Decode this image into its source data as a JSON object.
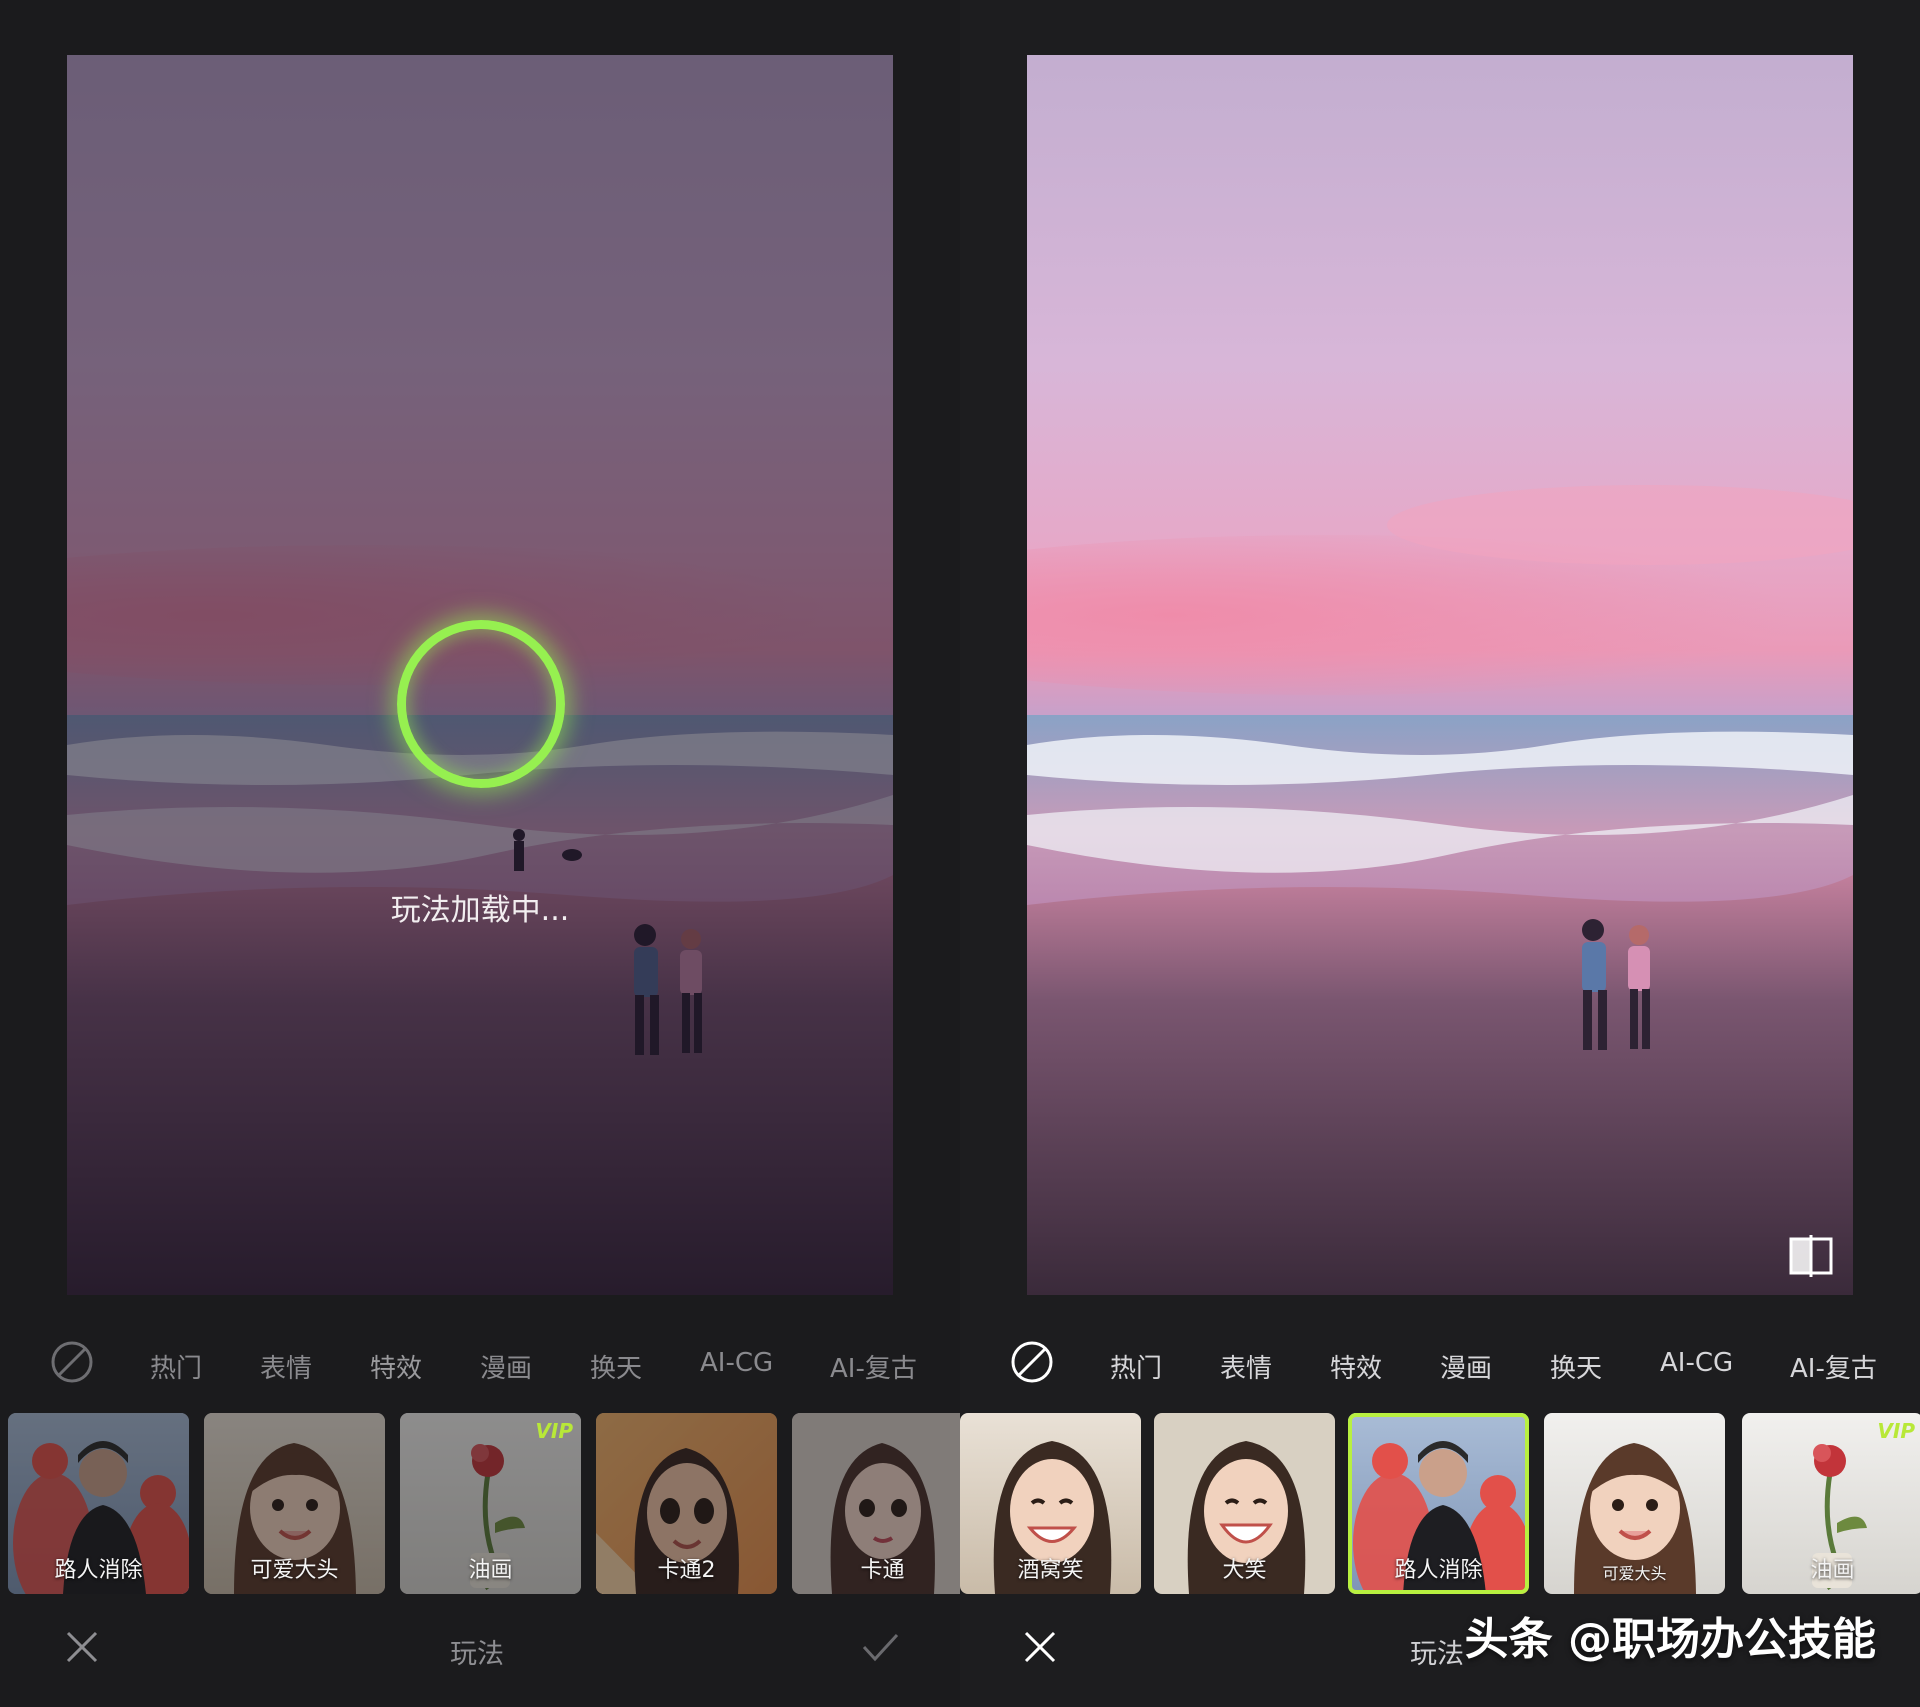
{
  "left": {
    "loading_text": "玩法加载中...",
    "tabs": [
      "热门",
      "表情",
      "特效",
      "漫画",
      "换天",
      "AI-CG",
      "AI-复古"
    ],
    "thumbs": [
      {
        "label": "路人消除"
      },
      {
        "label": "可爱大头"
      },
      {
        "label": "油画",
        "badge": "VIP"
      },
      {
        "label": "卡通2"
      },
      {
        "label": "卡通"
      }
    ],
    "bottom_label": "玩法"
  },
  "right": {
    "tabs": [
      "热门",
      "表情",
      "特效",
      "漫画",
      "换天",
      "AI-CG",
      "AI-复古"
    ],
    "active_tab": "特效",
    "thumbs": [
      {
        "label": "酒窝笑"
      },
      {
        "label": "大笑"
      },
      {
        "label": "路人消除",
        "selected": true
      },
      {
        "label": "可爱大头"
      },
      {
        "label": "油画",
        "badge": "VIP"
      }
    ],
    "bottom_label": "玩法"
  },
  "watermark": "头条 @职场办公技能",
  "colors": {
    "accent": "#b8f040",
    "loading_ring": "#96f050",
    "bg": "#1b1b1d"
  }
}
